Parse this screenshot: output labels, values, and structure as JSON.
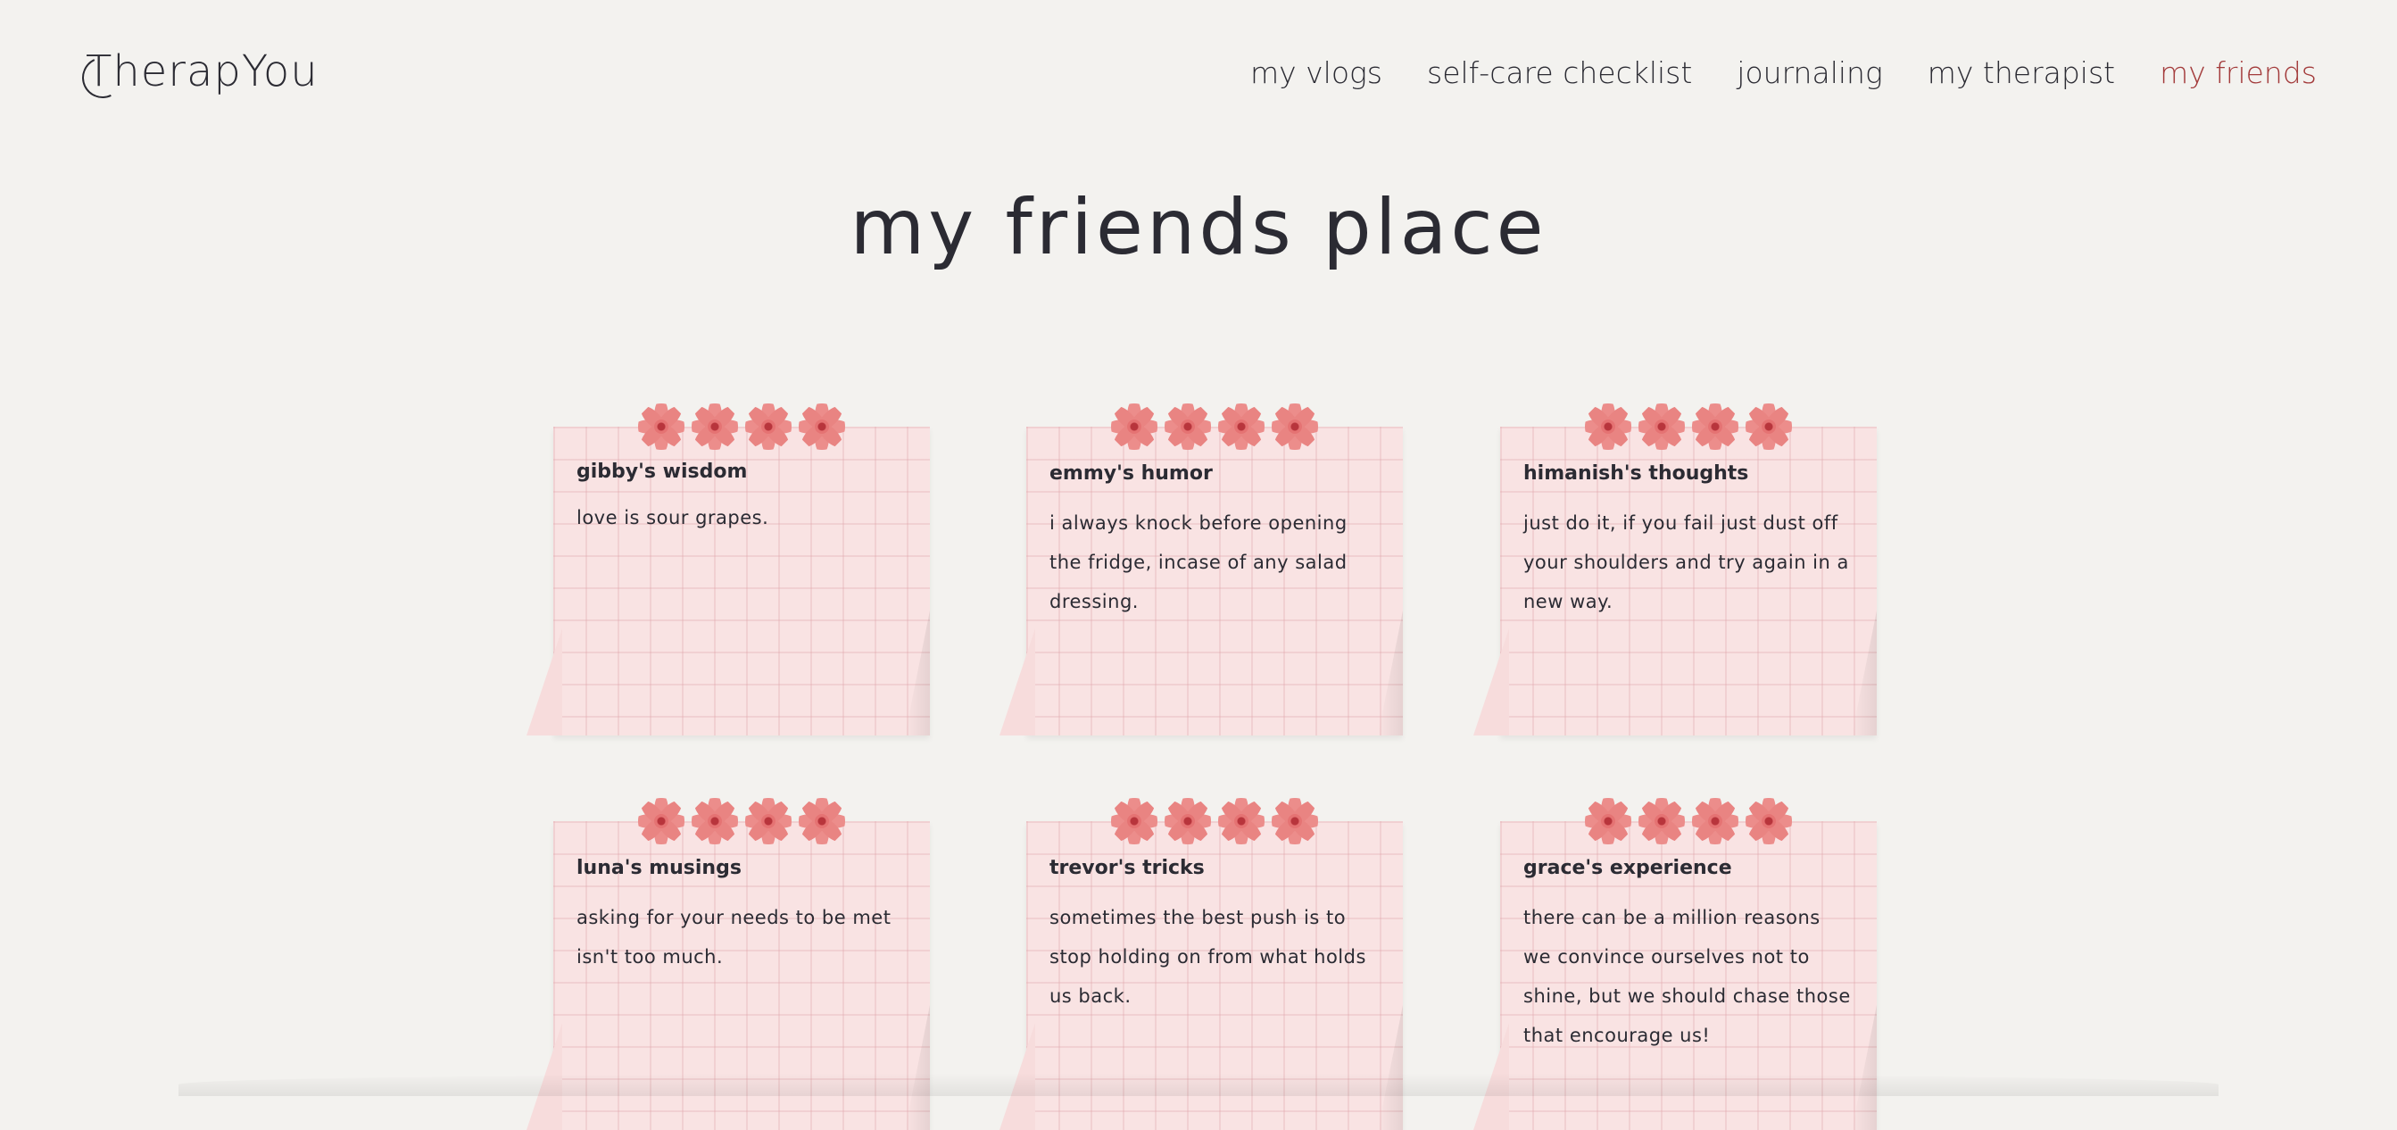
{
  "header": {
    "logo": "TherapYou",
    "nav": [
      {
        "label": "my vlogs",
        "active": false
      },
      {
        "label": "self-care checklist",
        "active": false
      },
      {
        "label": "journaling",
        "active": false
      },
      {
        "label": "my therapist",
        "active": false
      },
      {
        "label": "my friends",
        "active": true
      }
    ]
  },
  "page_title": "my friends place",
  "notes": [
    {
      "title": "gibby's wisdom",
      "body": "love is sour grapes."
    },
    {
      "title": "emmy's humor",
      "body": "i always knock before opening the fridge, incase of any salad dressing."
    },
    {
      "title": "himanish's thoughts",
      "body": "just do it, if you fail just dust off your shoulders and try again in a new way."
    },
    {
      "title": "luna's musings",
      "body": "asking for your needs to be met isn't too much."
    },
    {
      "title": "trevor's tricks",
      "body": "sometimes the best push is to stop holding on from what holds us back."
    },
    {
      "title": "grace's experience",
      "body": "there can be a million reasons we convince ourselves not to shine, but we should chase those that encourage us!"
    }
  ],
  "colors": {
    "background": "#f3f2ef",
    "note": "#f9e3e3",
    "active_nav": "#a33b3b",
    "flower": "#ec8d8b"
  },
  "icons": {
    "note_decoration": "flower-icon"
  }
}
